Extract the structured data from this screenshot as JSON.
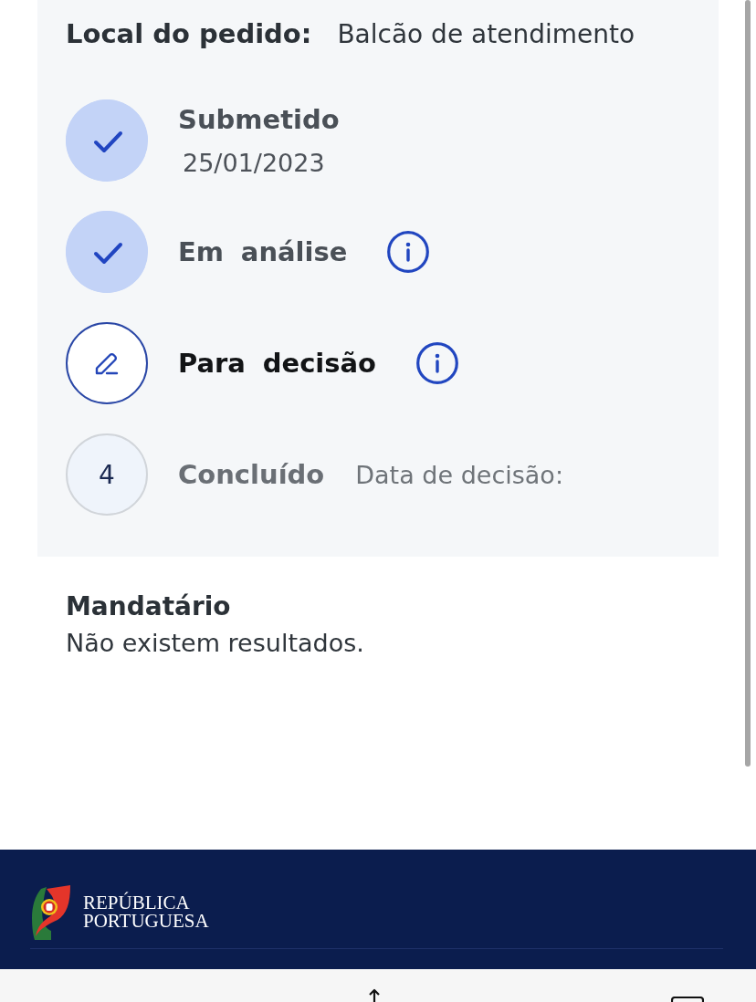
{
  "order_location": {
    "label": "Local do pedido:",
    "value": "Balcão de atendimento"
  },
  "steps": [
    {
      "kind": "done",
      "label": "Submetido",
      "date": "25/01/2023",
      "has_info": false
    },
    {
      "kind": "done",
      "label": "Em análise",
      "has_info": true
    },
    {
      "kind": "current",
      "label": "Para decisão",
      "has_info": true
    },
    {
      "kind": "pending",
      "number": "4",
      "label": "Concluído",
      "detail": "Data de decisão:",
      "has_info": false
    }
  ],
  "mandatary": {
    "title": "Mandatário",
    "message": "Não existem resultados."
  },
  "footer": {
    "brand_lines": [
      "REPÚBLICA",
      "PORTUGUESA"
    ]
  }
}
